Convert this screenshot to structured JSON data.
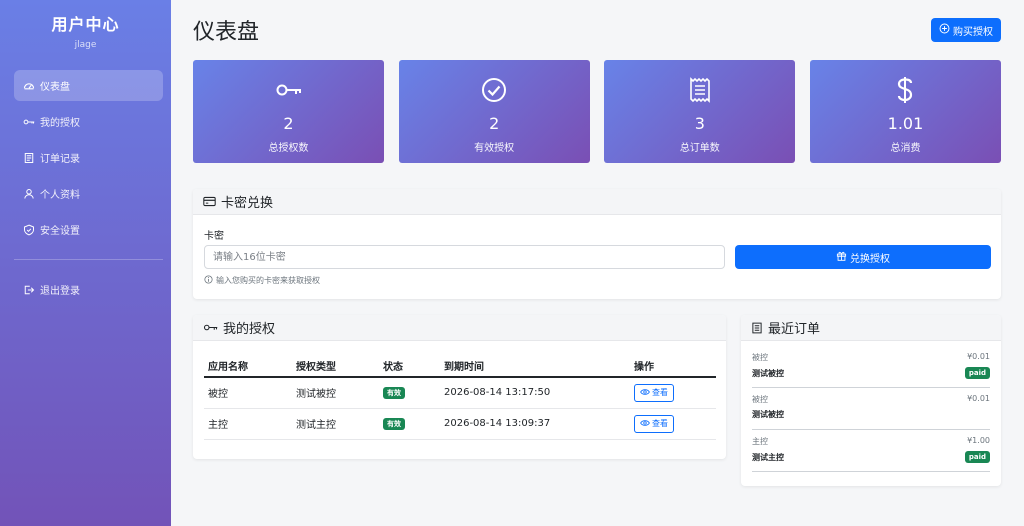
{
  "sidebar": {
    "title": "用户中心",
    "username": "jlage",
    "items": [
      {
        "label": "仪表盘",
        "icon": "dashboard-icon"
      },
      {
        "label": "我的授权",
        "icon": "key-icon"
      },
      {
        "label": "订单记录",
        "icon": "receipt-icon"
      },
      {
        "label": "个人资料",
        "icon": "person-icon"
      },
      {
        "label": "安全设置",
        "icon": "shield-icon"
      }
    ],
    "logout": "退出登录"
  },
  "header": {
    "title": "仪表盘",
    "buy_label": "购买授权"
  },
  "stats": [
    {
      "value": "2",
      "label": "总授权数",
      "icon": "key-icon"
    },
    {
      "value": "2",
      "label": "有效授权",
      "icon": "check-circle-icon"
    },
    {
      "value": "3",
      "label": "总订单数",
      "icon": "receipt-icon"
    },
    {
      "value": "1.01",
      "label": "总消费",
      "icon": "dollar-icon"
    }
  ],
  "redeem": {
    "title": "卡密兑换",
    "field_label": "卡密",
    "placeholder": "请输入16位卡密",
    "button": "兑换授权",
    "hint": "输入您购买的卡密来获取授权"
  },
  "licenses": {
    "title": "我的授权",
    "columns": [
      "应用名称",
      "授权类型",
      "状态",
      "到期时间",
      "操作"
    ],
    "rows": [
      {
        "app": "被控",
        "type": "测试被控",
        "status": "有效",
        "expires": "2026-08-14 13:17:50",
        "action": "查看"
      },
      {
        "app": "主控",
        "type": "测试主控",
        "status": "有效",
        "expires": "2026-08-14 13:09:37",
        "action": "查看"
      }
    ]
  },
  "orders": {
    "title": "最近订单",
    "items": [
      {
        "app": "被控",
        "amount": "¥0.01",
        "type": "测试被控",
        "status": "paid"
      },
      {
        "app": "被控",
        "amount": "¥0.01",
        "type": "测试被控",
        "status": ""
      },
      {
        "app": "主控",
        "amount": "¥1.00",
        "type": "测试主控",
        "status": "paid"
      }
    ]
  },
  "colors": {
    "primary": "#0d6efd",
    "success": "#198754",
    "gradient_start": "#6883e8",
    "gradient_end": "#7a4fb4"
  }
}
